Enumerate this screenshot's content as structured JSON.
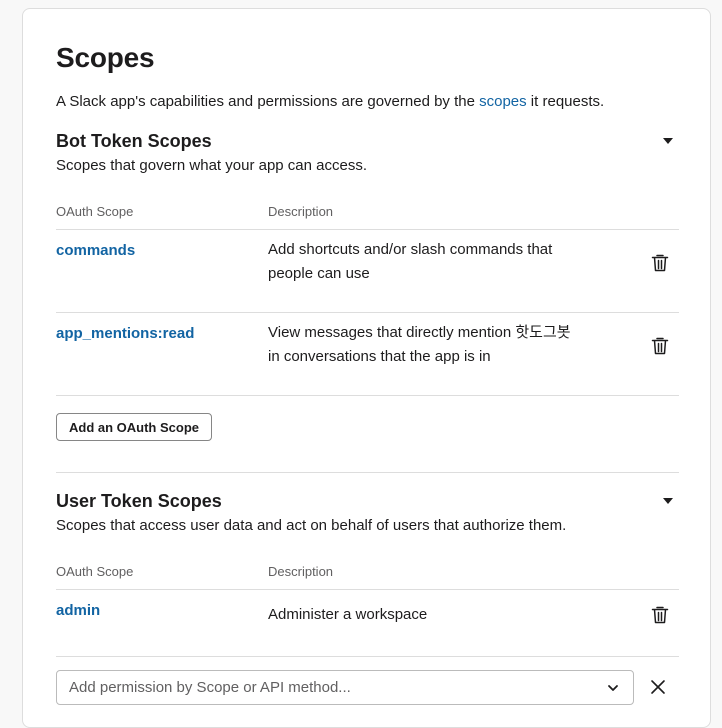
{
  "header": {
    "title": "Scopes",
    "intro_before": "A Slack app's capabilities and permissions are governed by the ",
    "intro_link": "scopes",
    "intro_after": " it requests."
  },
  "bot_section": {
    "title": "Bot Token Scopes",
    "subtitle": "Scopes that govern what your app can access.",
    "col_scope": "OAuth Scope",
    "col_desc": "Description",
    "rows": [
      {
        "name": "commands",
        "desc_line1": "Add shortcuts and/or slash commands that",
        "desc_line2": "people can use"
      },
      {
        "name": "app_mentions:read",
        "desc_line1": "View messages that directly mention 핫도그봇",
        "desc_line2": "in conversations that the app is in"
      }
    ],
    "add_button": "Add an OAuth Scope"
  },
  "user_section": {
    "title": "User Token Scopes",
    "subtitle": "Scopes that access user data and act on behalf of users that authorize them.",
    "col_scope": "OAuth Scope",
    "col_desc": "Description",
    "rows": [
      {
        "name": "admin",
        "desc": "Administer a workspace"
      }
    ],
    "add_placeholder": "Add permission by Scope or API method..."
  },
  "icons": {
    "delete": "trash-icon",
    "expand": "caret-down-icon",
    "dropdown": "chevron-down-icon",
    "dismiss": "close-icon"
  },
  "colors": {
    "link": "#1264a3",
    "text": "#1d1c1d",
    "muted": "#616061",
    "divider": "#dddddd"
  }
}
